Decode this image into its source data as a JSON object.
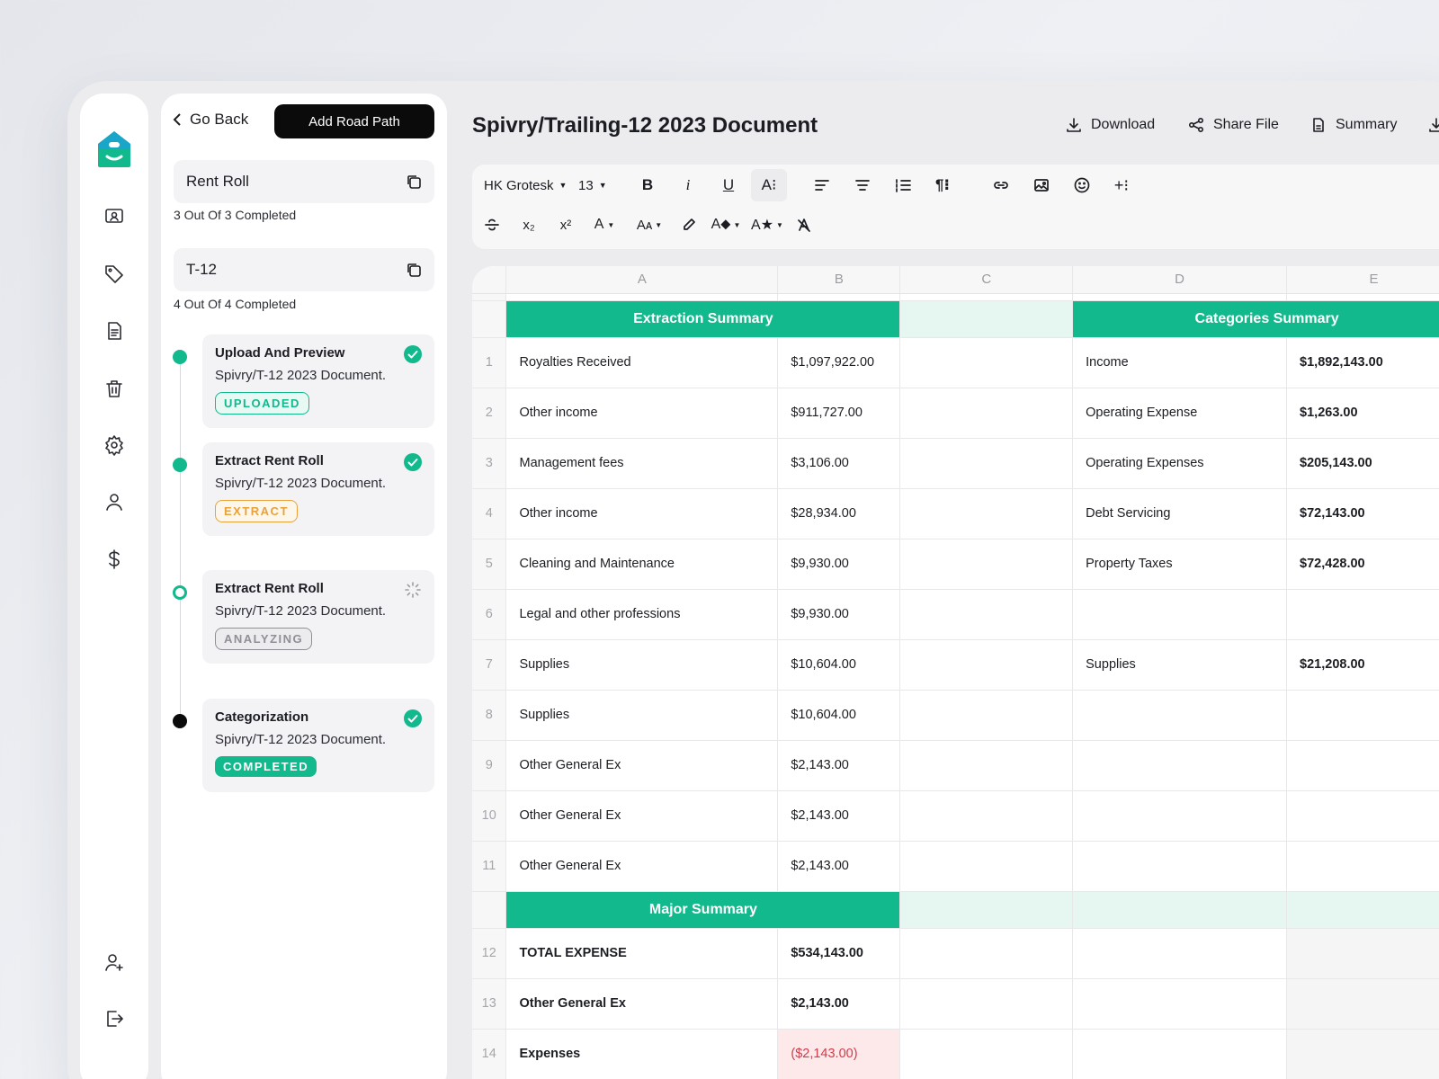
{
  "nav": {
    "back_label": "Go Back",
    "add_button": "Add Road Path"
  },
  "groups": [
    {
      "title": "Rent Roll",
      "status": "3 Out Of 3 Completed"
    },
    {
      "title": "T-12",
      "status": "4 Out Of 4 Completed"
    }
  ],
  "steps": [
    {
      "title": "Upload And Preview",
      "doc": "Spivry/T-12 2023 Document.",
      "badge": "UPLOADED",
      "state": "done"
    },
    {
      "title": "Extract Rent Roll",
      "doc": "Spivry/T-12 2023 Document.",
      "badge": "EXTRACT",
      "state": "done"
    },
    {
      "title": "Extract Rent Roll",
      "doc": "Spivry/T-12 2023 Document.",
      "badge": "ANALYZING",
      "state": "loading"
    },
    {
      "title": "Categorization",
      "doc": "Spivry/T-12 2023 Document.",
      "badge": "COMPLETED",
      "state": "done"
    }
  ],
  "header": {
    "title": "Spivry/Trailing-12 2023 Document",
    "download": "Download",
    "share": "Share File",
    "summary": "Summary"
  },
  "toolbar": {
    "font": "HK Grotesk",
    "size": "13"
  },
  "sheet": {
    "columns": [
      "A",
      "B",
      "C",
      "D",
      "E"
    ],
    "extraction_title": "Extraction Summary",
    "categories_title": "Categories Summary",
    "major_title": "Major Summary",
    "rows": [
      {
        "n": "1",
        "a": "Royalties Received",
        "b": "$1,097,922.00",
        "d": "Income",
        "e": "$1,892,143.00"
      },
      {
        "n": "2",
        "a": "Other income",
        "b": "$911,727.00",
        "d": "Operating Expense",
        "e": "$1,263.00"
      },
      {
        "n": "3",
        "a": "Management fees",
        "b": "$3,106.00",
        "d": "Operating Expenses",
        "e": "$205,143.00"
      },
      {
        "n": "4",
        "a": "Other income",
        "b": "$28,934.00",
        "d": "Debt Servicing",
        "e": "$72,143.00"
      },
      {
        "n": "5",
        "a": "Cleaning and Maintenance",
        "b": "$9,930.00",
        "d": "Property Taxes",
        "e": "$72,428.00"
      },
      {
        "n": "6",
        "a": "Legal and other professions",
        "b": "$9,930.00",
        "d": "",
        "e": ""
      },
      {
        "n": "7",
        "a": "Supplies",
        "b": "$10,604.00",
        "d": "Supplies",
        "e": "$21,208.00"
      },
      {
        "n": "8",
        "a": "Supplies",
        "b": "$10,604.00",
        "d": "",
        "e": ""
      },
      {
        "n": "9",
        "a": "Other General Ex",
        "b": "$2,143.00",
        "d": "",
        "e": ""
      },
      {
        "n": "10",
        "a": "Other General Ex",
        "b": "$2,143.00",
        "d": "",
        "e": ""
      },
      {
        "n": "11",
        "a": "Other General Ex",
        "b": "$2,143.00",
        "d": "",
        "e": ""
      }
    ],
    "major_rows": [
      {
        "n": "12",
        "a": "TOTAL EXPENSE",
        "b": "$534,143.00"
      },
      {
        "n": "13",
        "a": "Other General Ex",
        "b": "$2,143.00"
      },
      {
        "n": "14",
        "a": "Expenses",
        "b": "($2,143.00)"
      }
    ]
  },
  "colors": {
    "accent": "#12b98d",
    "accent_light": "#e6f7f2",
    "negative": "#d03c4a",
    "extract_badge": "#e9a23b"
  }
}
